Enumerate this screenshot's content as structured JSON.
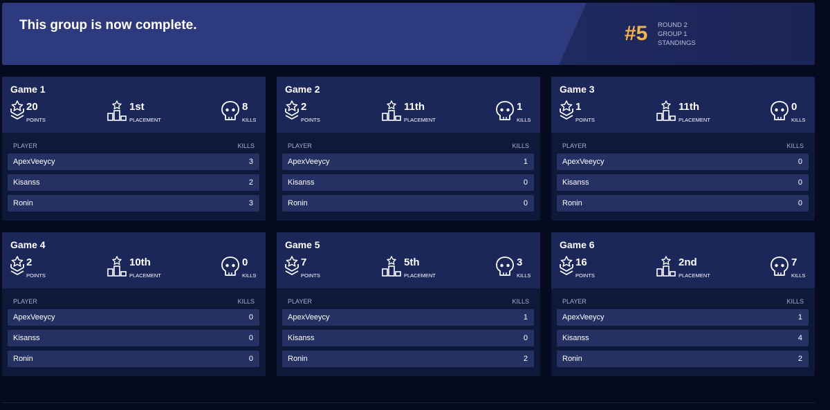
{
  "banner": {
    "title": "This group is now complete.",
    "rank": "#5",
    "round": "ROUND 2",
    "group": "GROUP 1",
    "standings": "STANDINGS"
  },
  "labels": {
    "points": "POINTS",
    "placement": "PLACEMENT",
    "kills": "KILLS",
    "player_header": "PLAYER",
    "kills_header": "KILLS"
  },
  "colors": {
    "accent": "#f6b24c",
    "banner_bg": "#2e3a7e",
    "card_bg": "#0e1838",
    "row_bg": "#263163"
  },
  "icons": {
    "points": "points-chevron-star-icon",
    "placement": "podium-star-icon",
    "kills": "skull-icon"
  },
  "games": [
    {
      "title": "Game 1",
      "points": "20",
      "placement": "1st",
      "kills": "8",
      "players": [
        {
          "name": "ApexVeeycy",
          "kills": "3"
        },
        {
          "name": "Kisanss",
          "kills": "2"
        },
        {
          "name": "Ronin",
          "kills": "3"
        }
      ]
    },
    {
      "title": "Game 2",
      "points": "2",
      "placement": "11th",
      "kills": "1",
      "players": [
        {
          "name": "ApexVeeycy",
          "kills": "1"
        },
        {
          "name": "Kisanss",
          "kills": "0"
        },
        {
          "name": "Ronin",
          "kills": "0"
        }
      ]
    },
    {
      "title": "Game 3",
      "points": "1",
      "placement": "11th",
      "kills": "0",
      "players": [
        {
          "name": "ApexVeeycy",
          "kills": "0"
        },
        {
          "name": "Kisanss",
          "kills": "0"
        },
        {
          "name": "Ronin",
          "kills": "0"
        }
      ]
    },
    {
      "title": "Game 4",
      "points": "2",
      "placement": "10th",
      "kills": "0",
      "players": [
        {
          "name": "ApexVeeycy",
          "kills": "0"
        },
        {
          "name": "Kisanss",
          "kills": "0"
        },
        {
          "name": "Ronin",
          "kills": "0"
        }
      ]
    },
    {
      "title": "Game 5",
      "points": "7",
      "placement": "5th",
      "kills": "3",
      "players": [
        {
          "name": "ApexVeeycy",
          "kills": "1"
        },
        {
          "name": "Kisanss",
          "kills": "0"
        },
        {
          "name": "Ronin",
          "kills": "2"
        }
      ]
    },
    {
      "title": "Game 6",
      "points": "16",
      "placement": "2nd",
      "kills": "7",
      "players": [
        {
          "name": "ApexVeeycy",
          "kills": "1"
        },
        {
          "name": "Kisanss",
          "kills": "4"
        },
        {
          "name": "Ronin",
          "kills": "2"
        }
      ]
    }
  ]
}
